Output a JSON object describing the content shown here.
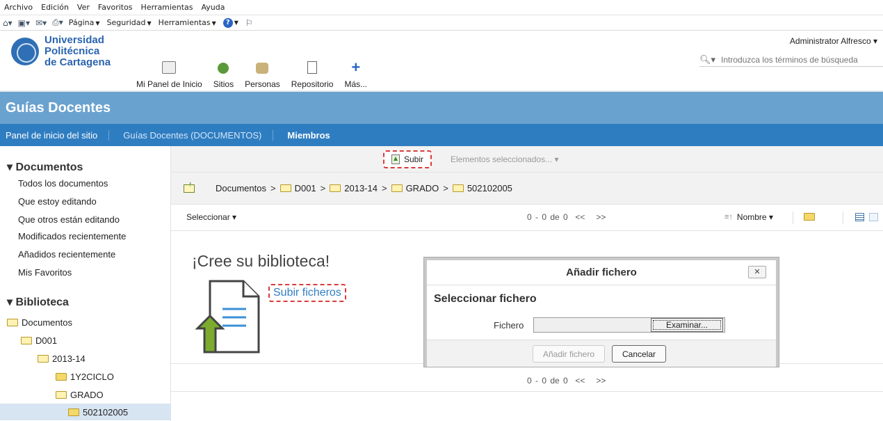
{
  "browser": {
    "menu": [
      "Archivo",
      "Edición",
      "Ver",
      "Favoritos",
      "Herramientas",
      "Ayuda"
    ],
    "commands": [
      "Página",
      "Seguridad",
      "Herramientas"
    ]
  },
  "header": {
    "logo_lines": [
      "Universidad",
      "Politécnica",
      "de Cartagena"
    ],
    "nav": [
      "Mi Panel de Inicio",
      "Sitios",
      "Personas",
      "Repositorio",
      "Más..."
    ],
    "user": "Administrator Alfresco",
    "search_placeholder": "Introduzca los términos de búsqueda"
  },
  "site": {
    "title": "Guías Docentes",
    "nav": [
      "Panel de inicio del sitio",
      "Guías Docentes (DOCUMENTOS)",
      "Miembros"
    ]
  },
  "sidebar": {
    "documents_heading": "Documentos",
    "document_links": [
      "Todos los documentos",
      "Que estoy editando",
      "Que otros están editando",
      "Modificados recientemente",
      "Añadidos recientemente",
      "Mis Favoritos"
    ],
    "library_heading": "Biblioteca",
    "tree": [
      "Documentos",
      "D001",
      "2013-14",
      "1Y2CICLO",
      "GRADO",
      "502102005"
    ]
  },
  "toolbar": {
    "upload": "Subir",
    "selected_items": "Elementos seleccionados..."
  },
  "breadcrumb": [
    "Documentos",
    "D001",
    "2013-14",
    "GRADO",
    "502102005"
  ],
  "list": {
    "select": "Seleccionar",
    "paging": "0 - 0 de 0  <<   >>",
    "sort": "Nombre"
  },
  "empty": {
    "title": "¡Cree su biblioteca!",
    "upload_link": "Subir ficheros"
  },
  "dialog": {
    "title": "Añadir fichero",
    "subtitle": "Seleccionar fichero",
    "file_label": "Fichero",
    "browse": "Examinar...",
    "add": "Añadir fichero",
    "cancel": "Cancelar"
  },
  "colors": {
    "site_title_bg": "#6aa2cf",
    "site_nav_bg": "#2f7dc1",
    "highlight": "#d93a3a"
  }
}
